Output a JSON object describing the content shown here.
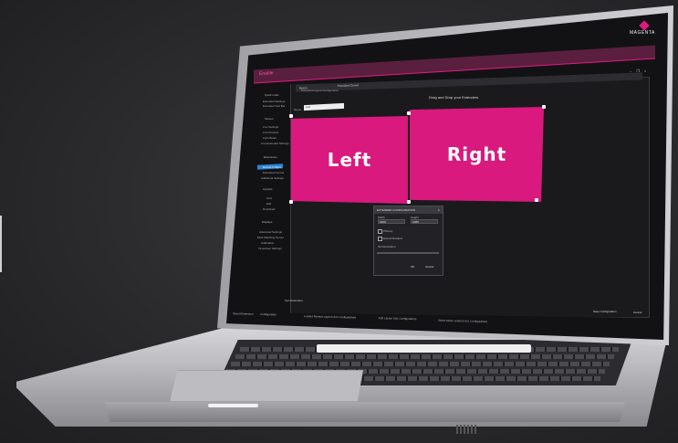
{
  "app": {
    "title": "Enable",
    "brand": "MAGENTA"
  },
  "sidebar": {
    "sections": [
      {
        "title": "Quick Links",
        "items": [
          "Extended Settings",
          "Extended Tool Bar"
        ]
      },
      {
        "title": "Screen",
        "items": [
          "Live Settings",
          "Live Preview",
          "Light Beam",
          "Live Extended Settings"
        ]
      },
      {
        "title": "Extensions",
        "items": [
          "Extend 2 Right",
          "Extended Control",
          "Additional Settings"
        ]
      },
      {
        "title": "Layouts",
        "items": [
          "Grid",
          "Edit",
          "Download"
        ]
      },
      {
        "title": "Displays",
        "items": [
          "Advanced Settings",
          "Multi Matching Server",
          "Calibration",
          "Timesheet Settings"
        ]
      }
    ],
    "active_item": "Extend 2 Right"
  },
  "tabs": [
    "Basics",
    "Extended Cloned"
  ],
  "content": {
    "subtitle": "Extended Layout Configuration",
    "drag_title": "Drag and Drop your Extenders",
    "name_label": "Name",
    "name_value": "Left",
    "displays": [
      {
        "label": "Left"
      },
      {
        "label": "Right"
      }
    ],
    "bottom_left": "Sort Extenders",
    "save_button": "Save Configuration",
    "cancel_button": "Cancel"
  },
  "dialog": {
    "title": "EXTENDER CONFIGURATION",
    "close": "×",
    "width_label": "Width",
    "width_value": "1920",
    "height_label": "Height",
    "height_value": "1080",
    "check1": "Primary",
    "check2": "Extend Rotated",
    "slider_label": "Set Resolution",
    "ok": "OK",
    "cancel": "Cancel"
  },
  "statusbar": {
    "items": [
      "Saved Extension",
      "Configuration",
      "Loaded Monitor Layout (4x1 Configuration)",
      "Edit Layout (4x1 Configuration)",
      "Select Mode: Extend (4x1 Configuration)"
    ]
  },
  "window_controls": "– ❐ ×",
  "colors": {
    "accent": "#e0197f",
    "active_nav": "#2a86d6",
    "background": "#2a2a2c"
  }
}
